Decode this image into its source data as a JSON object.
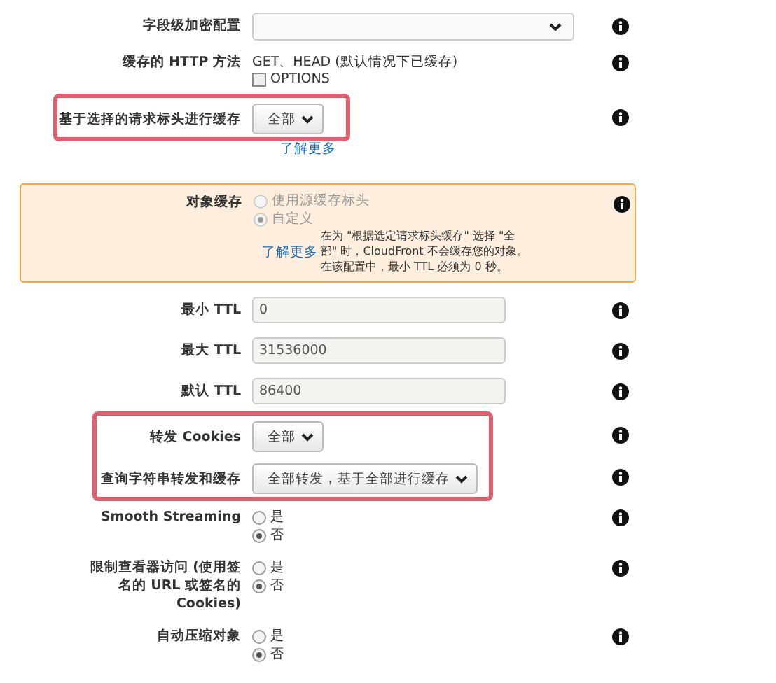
{
  "rows": [
    {
      "kind": "select",
      "label": "字段级加密配置",
      "value": ""
    },
    {
      "kind": "methods",
      "label": "缓存的 HTTP 方法",
      "text": "GET、HEAD (默认情况下已缓存)",
      "checkbox": {
        "label": "OPTIONS",
        "checked": false
      }
    },
    {
      "kind": "dropdown",
      "label": "基于选择的请求标头进行缓存",
      "value": "全部",
      "highlighted": true,
      "link": "了解更多"
    },
    {
      "kind": "notice",
      "label": "对象缓存",
      "options": [
        {
          "label": "使用源缓存标头",
          "selected": false,
          "disabled": true
        },
        {
          "label": "自定义",
          "selected": true,
          "disabled": true
        }
      ],
      "link": "了解更多",
      "message": "在为 \"根据选定请求标头缓存\" 选择 \"全部\" 时，CloudFront 不会缓存您的对象。在该配置中，最小 TTL 必须为 0 秒。"
    },
    {
      "kind": "input",
      "label": "最小 TTL",
      "value": "0"
    },
    {
      "kind": "input",
      "label": "最大 TTL",
      "value": "31536000"
    },
    {
      "kind": "input",
      "label": "默认 TTL",
      "value": "86400"
    },
    {
      "kind": "dropdown",
      "label": "转发 Cookies",
      "value": "全部",
      "highlighted": true
    },
    {
      "kind": "dropdown",
      "label": "查询字符串转发和缓存",
      "value": "全部转发，基于全部进行缓存",
      "highlighted": true
    },
    {
      "kind": "radio",
      "label": "Smooth Streaming",
      "options": [
        {
          "label": "是",
          "selected": false
        },
        {
          "label": "否",
          "selected": true
        }
      ]
    },
    {
      "kind": "radio",
      "label": "限制查看器访问 (使用签名的 URL 或签名的 Cookies)",
      "options": [
        {
          "label": "是",
          "selected": false
        },
        {
          "label": "否",
          "selected": true
        }
      ]
    },
    {
      "kind": "radio",
      "label": "自动压缩对象",
      "options": [
        {
          "label": "是",
          "selected": false
        },
        {
          "label": "否",
          "selected": true
        }
      ]
    }
  ]
}
